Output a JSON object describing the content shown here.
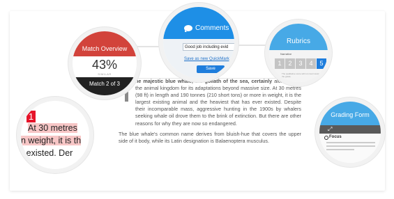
{
  "match_overview": {
    "title": "Match Overview",
    "percentage": "43%",
    "similarity_label": "SIMILAR",
    "match_count": "Match 2 of 3",
    "accent_color": "#d2433b"
  },
  "comments": {
    "title": "Comments",
    "input_value": "Good job including evid",
    "quickmark_link": "Save as new QuickMark",
    "save_label": "Save",
    "accent_color": "#1e8fe6",
    "icon": "speech-bubble-icon"
  },
  "rubrics": {
    "title": "Rubrics",
    "criterion_label": "Narrative",
    "scale": [
      "1",
      "2",
      "3",
      "4",
      "5"
    ],
    "selected_score": "5",
    "hint": "The qualitative score will not count toward the grade.",
    "accent_color": "#47a9e6"
  },
  "grading_form": {
    "title": "Grading Form",
    "section_title": "Focus",
    "expand_icon": "expand-icon",
    "info_icon": "info-icon",
    "accent_color": "#47a9e6"
  },
  "zoom_text": {
    "marker": "1",
    "line1": "At 30 metres",
    "line2": "n weight, it is th",
    "line3": "r existed. Der",
    "marker_color": "#e6142a"
  },
  "document": {
    "paragraph1_lead": "he majestic blue whale, the goliath of the sea, certainly",
    "paragraph1_rest": " alone within the animal kingdom for its adaptations beyond massive size. At 30 metres (98 ft) in length and 190 tonnes (210 short tons) or more in weight, it is the largest existing animal and the heaviest that has ever existed. Despite their incomparable mass, aggressive hunting in the 1900s by whalers seeking whale oil drove them to the brink of extinction. But there are other reasons for why they are now so endangered.",
    "paragraph2": "The blue whale's common name derives from bluish-hue that covers the upper side of it body, while its Latin designation is Balaenoptera musculus."
  }
}
